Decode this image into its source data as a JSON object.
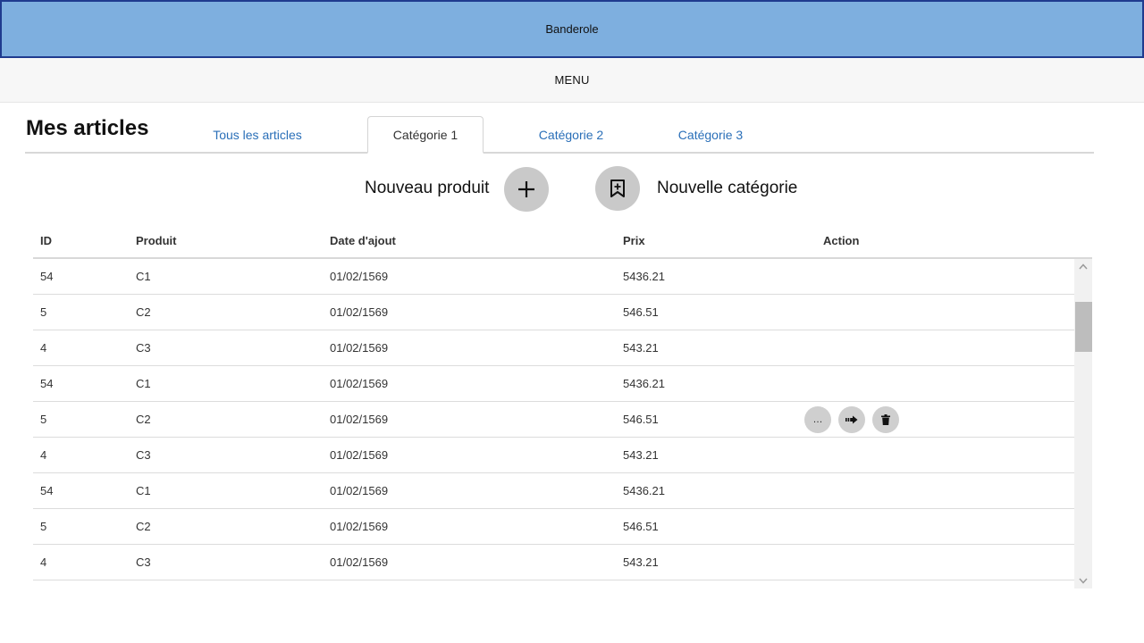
{
  "banner": {
    "label": "Banderole"
  },
  "menu": {
    "label": "MENU"
  },
  "page": {
    "title": "Mes articles"
  },
  "tabs": [
    {
      "label": "Tous les articles",
      "active": false
    },
    {
      "label": "Catégorie 1",
      "active": true
    },
    {
      "label": "Catégorie 2",
      "active": false
    },
    {
      "label": "Catégorie 3",
      "active": false
    }
  ],
  "actions": {
    "new_product_label": "Nouveau produit",
    "new_category_label": "Nouvelle catégorie"
  },
  "table": {
    "columns": [
      "ID",
      "Produit",
      "Date d'ajout",
      "Prix",
      "Action"
    ],
    "rows": [
      {
        "id": "54",
        "product": "C1",
        "date": "01/02/1569",
        "price": "5436.21"
      },
      {
        "id": "5",
        "product": "C2",
        "date": "01/02/1569",
        "price": "546.51"
      },
      {
        "id": "4",
        "product": "C3",
        "date": "01/02/1569",
        "price": "543.21"
      },
      {
        "id": "54",
        "product": "C1",
        "date": "01/02/1569",
        "price": "5436.21"
      },
      {
        "id": "5",
        "product": "C2",
        "date": "01/02/1569",
        "price": "546.51"
      },
      {
        "id": "4",
        "product": "C3",
        "date": "01/02/1569",
        "price": "543.21"
      },
      {
        "id": "54",
        "product": "C1",
        "date": "01/02/1569",
        "price": "5436.21"
      },
      {
        "id": "5",
        "product": "C2",
        "date": "01/02/1569",
        "price": "546.51"
      },
      {
        "id": "4",
        "product": "C3",
        "date": "01/02/1569",
        "price": "543.21"
      }
    ],
    "row_action_icons": [
      "more-icon",
      "move-icon",
      "trash-icon"
    ],
    "row_action_more_label": "…"
  },
  "colors": {
    "banner_bg": "#7eafdf",
    "banner_border": "#1f3b8f",
    "link": "#2a6fb8",
    "button_gray": "#c9c9c9"
  }
}
